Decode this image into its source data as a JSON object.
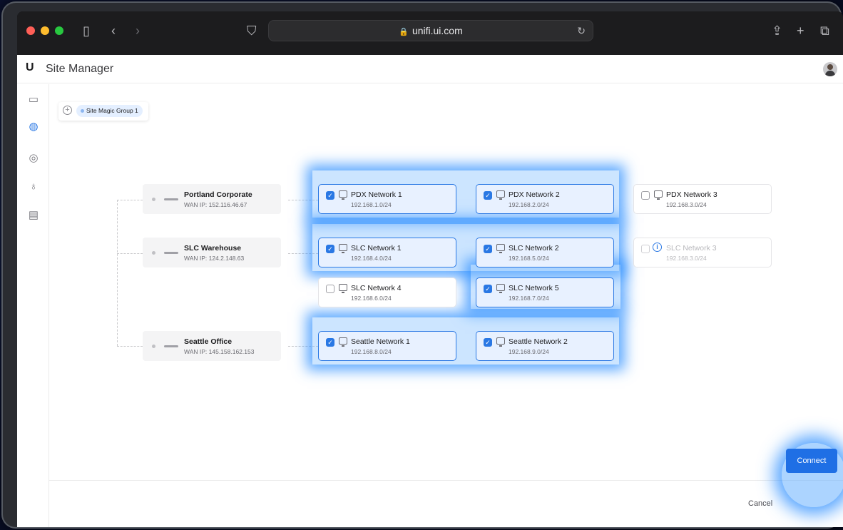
{
  "browser": {
    "url": "unifi.ui.com"
  },
  "app": {
    "logo": "U",
    "title": "Site Manager"
  },
  "sidebar": {
    "items": [
      {
        "name": "devices",
        "icon": "router-icon"
      },
      {
        "name": "site-magic",
        "icon": "globe-network-icon",
        "active": true
      },
      {
        "name": "cameras",
        "icon": "camera-icon"
      },
      {
        "name": "users",
        "icon": "users-gear-icon"
      },
      {
        "name": "logs",
        "icon": "clipboard-icon"
      }
    ]
  },
  "group": {
    "label": "Site Magic Group 1"
  },
  "sites": [
    {
      "name": "Portland Corporate",
      "wan": "WAN IP: 152.116.46.67"
    },
    {
      "name": "SLC Warehouse",
      "wan": "WAN IP: 124.2.148.63"
    },
    {
      "name": "Seattle Office",
      "wan": "WAN IP: 145.158.162.153"
    }
  ],
  "networks": [
    {
      "name": "PDX Network 1",
      "subnet": "192.168.1.0/24",
      "checked": true
    },
    {
      "name": "PDX Network 2",
      "subnet": "192.168.2.0/24",
      "checked": true
    },
    {
      "name": "PDX Network 3",
      "subnet": "192.168.3.0/24",
      "checked": false
    },
    {
      "name": "SLC Network 1",
      "subnet": "192.168.4.0/24",
      "checked": true
    },
    {
      "name": "SLC Network 2",
      "subnet": "192.168.5.0/24",
      "checked": true
    },
    {
      "name": "SLC Network 3",
      "subnet": "192.168.3.0/24",
      "checked": false,
      "disabled": true
    },
    {
      "name": "SLC Network 4",
      "subnet": "192.168.6.0/24",
      "checked": false
    },
    {
      "name": "SLC Network 5",
      "subnet": "192.168.7.0/24",
      "checked": true
    },
    {
      "name": "Seattle Network 1",
      "subnet": "192.168.8.0/24",
      "checked": true
    },
    {
      "name": "Seattle Network 2",
      "subnet": "192.168.9.0/24",
      "checked": true
    }
  ],
  "footer": {
    "cancel_label": "Cancel",
    "connect_label": "Connect"
  },
  "colors": {
    "accent": "#2a78e4",
    "glow": "#288cff"
  }
}
